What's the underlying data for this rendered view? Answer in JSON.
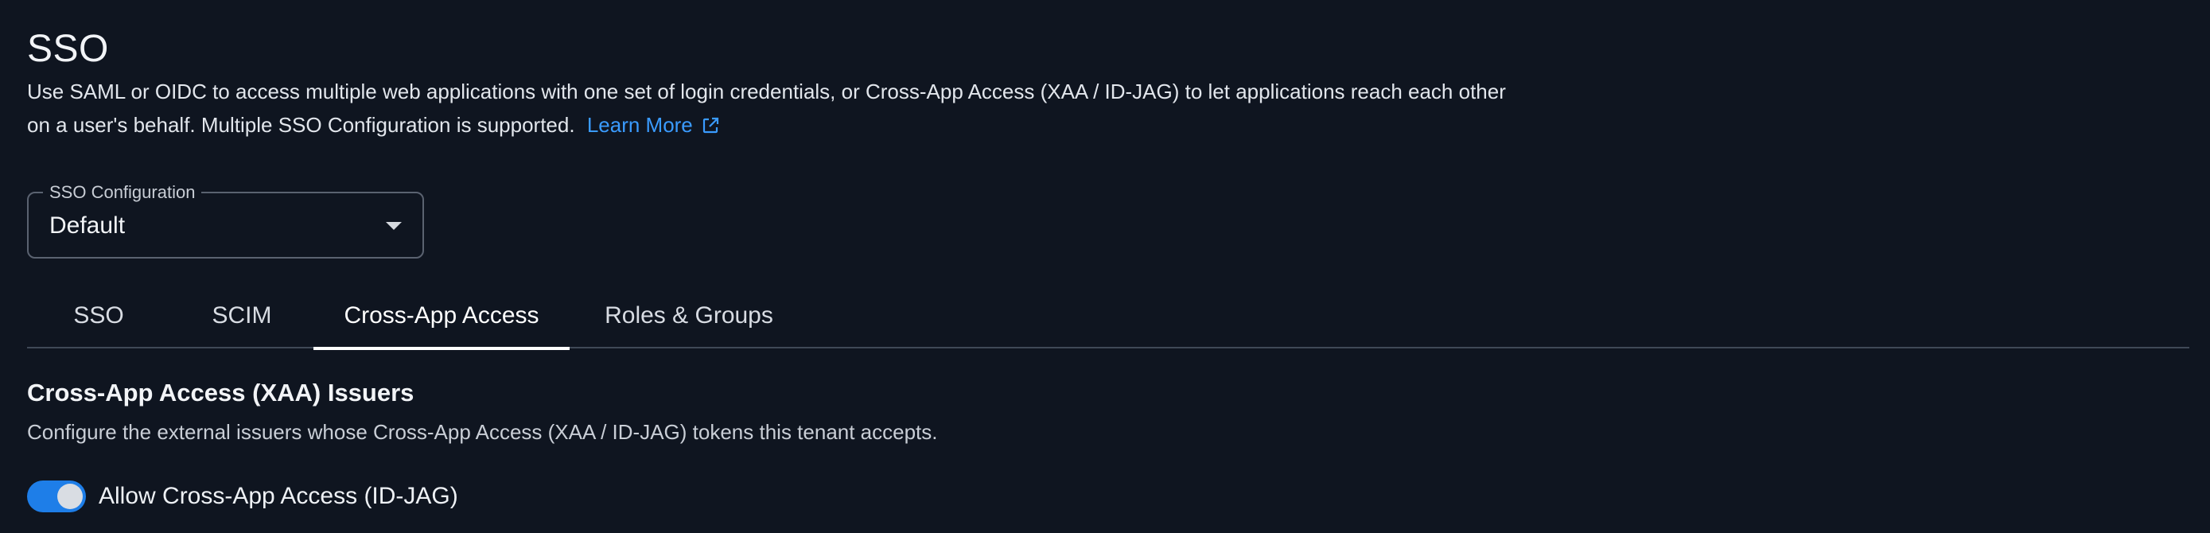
{
  "header": {
    "title": "SSO",
    "description": "Use SAML or OIDC to access multiple web applications with one set of login credentials, or Cross-App Access (XAA / ID-JAG) to let applications reach each other on a user's behalf. Multiple SSO Configuration is supported.",
    "learn_more": "Learn More",
    "learn_more_icon": "external-link-icon",
    "link_color": "#3a9bff"
  },
  "sso_configuration": {
    "label": "SSO Configuration",
    "value": "Default"
  },
  "tabs": [
    {
      "label": "SSO",
      "active": false
    },
    {
      "label": "SCIM",
      "active": false
    },
    {
      "label": "Cross-App Access",
      "active": true
    },
    {
      "label": "Roles & Groups",
      "active": false
    }
  ],
  "section": {
    "title": "Cross-App Access (XAA) Issuers",
    "description": "Configure the external issuers whose Cross-App Access (XAA / ID-JAG) tokens this tenant accepts."
  },
  "toggle": {
    "label": "Allow Cross-App Access (ID-JAG)",
    "on": true,
    "color": "#1e7ee8"
  },
  "colors": {
    "background": "#0f1520",
    "text": "#e6e9ee"
  }
}
